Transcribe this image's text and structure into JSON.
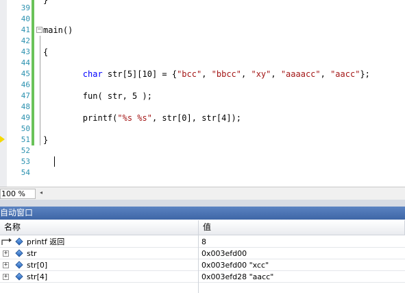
{
  "editor": {
    "lines": [
      {
        "no": "39",
        "code": "",
        "changed": true
      },
      {
        "no": "40",
        "code": "",
        "changed": true
      },
      {
        "no": "41",
        "code": "main()",
        "changed": true,
        "fold": "−"
      },
      {
        "no": "42",
        "code": "",
        "changed": true
      },
      {
        "no": "43",
        "code": "{",
        "changed": true
      },
      {
        "no": "44",
        "code": "",
        "changed": true
      },
      {
        "no": "45",
        "code": "        char str[5][10] = {\"bcc\", \"bbcc\", \"xy\", \"aaaacc\", \"aacc\"};",
        "changed": true
      },
      {
        "no": "46",
        "code": "",
        "changed": true
      },
      {
        "no": "47",
        "code": "        fun( str, 5 );",
        "changed": true
      },
      {
        "no": "48",
        "code": "",
        "changed": true
      },
      {
        "no": "49",
        "code": "        printf(\"%s %s\", str[0], str[4]);",
        "changed": true
      },
      {
        "no": "50",
        "code": "",
        "changed": true
      },
      {
        "no": "51",
        "code": "}",
        "changed": true
      },
      {
        "no": "52",
        "code": "",
        "changed": false
      },
      {
        "no": "53",
        "code": "",
        "changed": false
      },
      {
        "no": "54",
        "code": "",
        "changed": false
      }
    ],
    "top_partial_code": "}"
  },
  "zoom": {
    "value": "100 %",
    "left_arrow": "◂"
  },
  "autos": {
    "title": "自动窗口",
    "columns": {
      "name": "名称",
      "value": "值"
    },
    "rows": [
      {
        "name": "printf 返回",
        "value": "8",
        "kind": "return"
      },
      {
        "name": "str",
        "value": "0x003efd00",
        "kind": "expand",
        "expander": "+"
      },
      {
        "name": "str[0]",
        "value": "0x003efd00 \"xcc\"",
        "kind": "expand",
        "expander": "+"
      },
      {
        "name": "str[4]",
        "value": "0x003efd28 \"aacc\"",
        "kind": "expand",
        "expander": "+"
      }
    ]
  },
  "colors": {
    "line_number": "#2b91af",
    "change_bar": "#6ac259",
    "keyword": "#0000ff",
    "string": "#a31515",
    "title_bar": "#4a72b2"
  }
}
